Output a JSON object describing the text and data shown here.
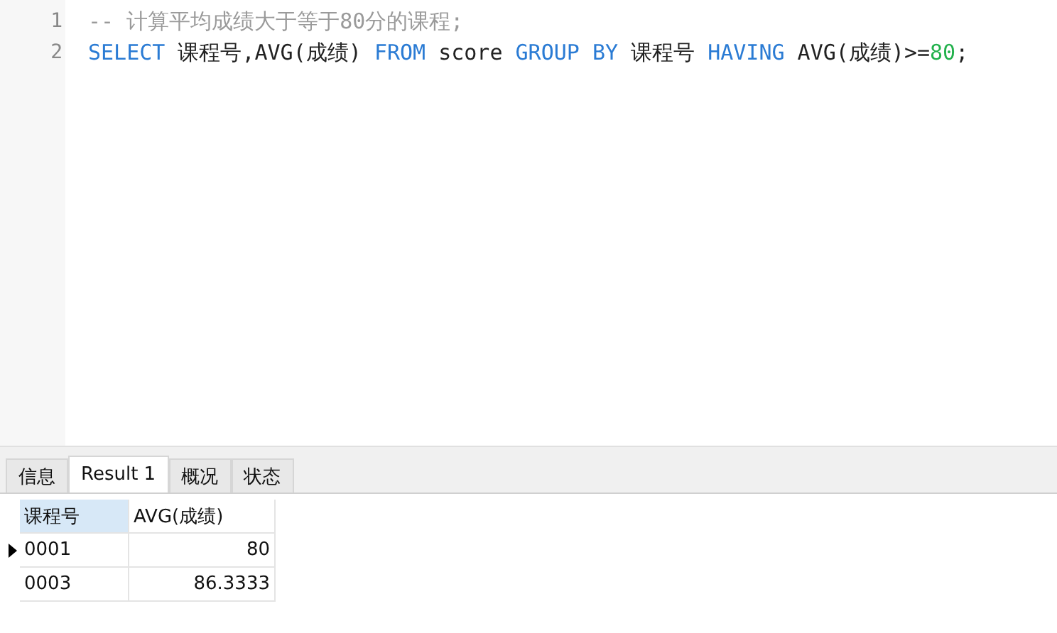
{
  "editor": {
    "lines": [
      {
        "number": "1",
        "tokens": [
          {
            "kind": "comment",
            "text": "-- 计算平均成绩大于等于80分的课程;"
          }
        ]
      },
      {
        "number": "2",
        "tokens": [
          {
            "kind": "keyword",
            "text": "SELECT"
          },
          {
            "kind": "plain",
            "text": " 课程号,AVG(成绩) "
          },
          {
            "kind": "keyword",
            "text": "FROM"
          },
          {
            "kind": "plain",
            "text": " score "
          },
          {
            "kind": "keyword",
            "text": "GROUP BY"
          },
          {
            "kind": "plain",
            "text": " 课程号 "
          },
          {
            "kind": "keyword",
            "text": "HAVING"
          },
          {
            "kind": "plain",
            "text": " AVG(成绩)>="
          },
          {
            "kind": "number",
            "text": "80"
          },
          {
            "kind": "plain",
            "text": ";"
          }
        ]
      }
    ]
  },
  "tabs": [
    {
      "label": "信息",
      "selected": false
    },
    {
      "label": "Result 1",
      "selected": true
    },
    {
      "label": "概况",
      "selected": false
    },
    {
      "label": "状态",
      "selected": false
    }
  ],
  "table": {
    "columns": [
      {
        "label": "课程号",
        "selected": true
      },
      {
        "label": "AVG(成绩)",
        "selected": false
      }
    ],
    "rows": [
      {
        "selected": true,
        "cells": [
          "0001",
          "80"
        ]
      },
      {
        "selected": false,
        "cells": [
          "0003",
          "86.3333"
        ]
      }
    ]
  }
}
